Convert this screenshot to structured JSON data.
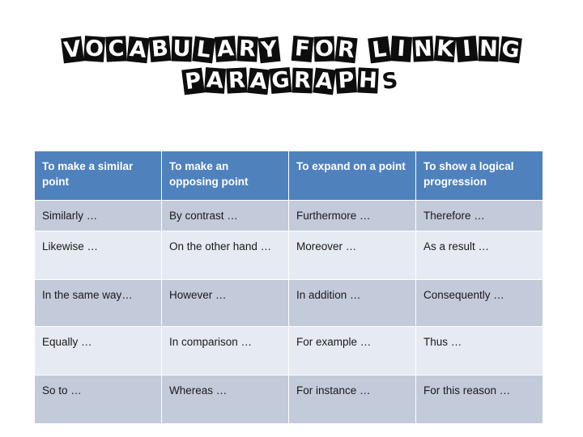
{
  "slide": {
    "background_color": "#ffffff",
    "title": {
      "line_1": "VOCABULARY FOR LINKING",
      "line_2": "PARAGRAPHS",
      "style": "ransom-note",
      "box_color": "#0d0d0d",
      "letter_color": "#ffffff"
    }
  },
  "table": {
    "header_color": "#4f81bd",
    "header_text_color": "#ffffff",
    "band_dark_color": "#c3cada",
    "band_light_color": "#e6eaf2",
    "grid_color": "#ffffff",
    "columns": [
      "To make a similar point",
      "To make an opposing point",
      "To expand on a point",
      "To show a logical progression"
    ],
    "rows": [
      [
        "Similarly …",
        "By contrast …",
        "Furthermore …",
        "Therefore …"
      ],
      [
        "Likewise …",
        "On the other hand …",
        "Moreover …",
        "As a result …"
      ],
      [
        "In the same way…",
        "However …",
        "In addition …",
        "Consequently …"
      ],
      [
        "Equally …",
        "In comparison …",
        "For example …",
        "Thus …"
      ],
      [
        "So to …",
        "Whereas …",
        "For instance …",
        "For this reason …"
      ]
    ]
  }
}
